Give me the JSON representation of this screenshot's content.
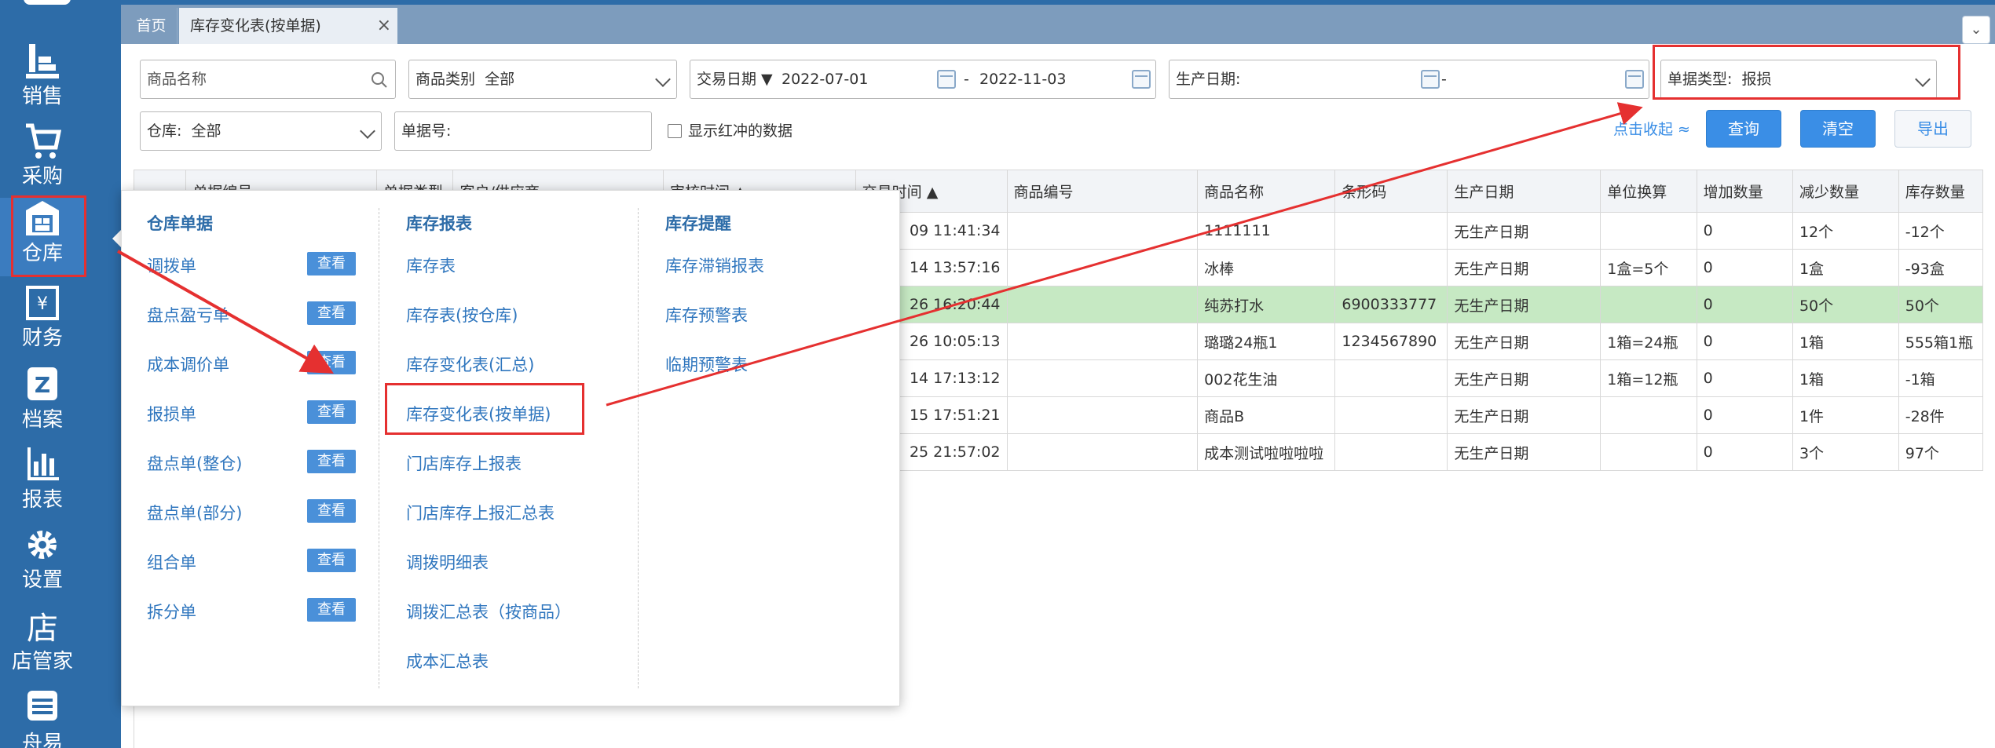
{
  "sidebar": {
    "items": [
      {
        "label": "销售",
        "icon": "sales-chart-icon"
      },
      {
        "label": "采购",
        "icon": "cart-icon"
      },
      {
        "label": "仓库",
        "icon": "warehouse-icon"
      },
      {
        "label": "财务",
        "icon": "yen-icon"
      },
      {
        "label": "档案",
        "icon": "archive-icon"
      },
      {
        "label": "报表",
        "icon": "report-chart-icon"
      },
      {
        "label": "设置",
        "icon": "gear-icon"
      },
      {
        "label": "店管家",
        "icon": "store-icon"
      },
      {
        "label": "舟易",
        "icon": "zhouyi-icon"
      }
    ],
    "active": "仓库"
  },
  "tabs": {
    "home": "首页",
    "current": "库存变化表(按单据)",
    "close": "×",
    "collapse_icon": "chevron-down-icon"
  },
  "filters": {
    "product_name_placeholder": "商品名称",
    "category_label": "商品类别",
    "category_value": "全部",
    "trade_date_label": "交易日期 ▼",
    "trade_date_from": "2022-07-01",
    "trade_date_sep": "-",
    "trade_date_to": "2022-11-03",
    "prod_date_label": "生产日期:",
    "prod_date_sep": "-",
    "doc_type_label": "单据类型:",
    "doc_type_value": "报损",
    "warehouse_label": "仓库:",
    "warehouse_value": "全部",
    "doc_no_label": "单据号:",
    "show_red_label": "显示红冲的数据",
    "collapse_link": "点击收起 ≈",
    "query_button": "查询",
    "clear_button": "清空",
    "export_button": "导出"
  },
  "table": {
    "partial_headers": [
      "单据编号",
      "单据类型",
      "客户/供应商",
      "审核时间 ▲",
      "交易时间 ▲"
    ],
    "headers": [
      "商品编号",
      "商品名称",
      "条形码",
      "生产日期",
      "单位换算",
      "增加数量",
      "减少数量",
      "库存数量"
    ],
    "rows": [
      {
        "time": "09 11:41:34",
        "code": "",
        "name": "1111111",
        "barcode": "",
        "prod_date": "无生产日期",
        "unit": "",
        "inc": "0",
        "dec": "12个",
        "stock": "-12个",
        "hl": false
      },
      {
        "time": "14 13:57:16",
        "code": "",
        "name": "冰棒",
        "barcode": "",
        "prod_date": "无生产日期",
        "unit": "1盒=5个",
        "inc": "0",
        "dec": "1盒",
        "stock": "-93盒",
        "hl": false
      },
      {
        "time": "26 16:20:44",
        "code": "",
        "name": "纯苏打水",
        "barcode": "6900333777",
        "prod_date": "无生产日期",
        "unit": "",
        "inc": "0",
        "dec": "50个",
        "stock": "50个",
        "hl": true
      },
      {
        "time": "26 10:05:13",
        "code": "",
        "name": "璐璐24瓶1",
        "barcode": "1234567890",
        "prod_date": "无生产日期",
        "unit": "1箱=24瓶",
        "inc": "0",
        "dec": "1箱",
        "stock": "555箱1瓶",
        "hl": false
      },
      {
        "time": "14 17:13:12",
        "code": "",
        "name": "002花生油",
        "barcode": "",
        "prod_date": "无生产日期",
        "unit": "1箱=12瓶",
        "inc": "0",
        "dec": "1箱",
        "stock": "-1箱",
        "hl": false
      },
      {
        "time": "15 17:51:21",
        "code": "",
        "name": "商品B",
        "barcode": "",
        "prod_date": "无生产日期",
        "unit": "",
        "inc": "0",
        "dec": "1件",
        "stock": "-28件",
        "hl": false
      },
      {
        "time": "25 21:57:02",
        "code": "",
        "name": "成本测试啦啦啦啦",
        "barcode": "",
        "prod_date": "无生产日期",
        "unit": "",
        "inc": "0",
        "dec": "3个",
        "stock": "97个",
        "hl": false
      }
    ]
  },
  "menu": {
    "col1_title": "仓库单据",
    "col1_items": [
      "调拨单",
      "盘点盈亏单",
      "成本调价单",
      "报损单",
      "盘点单(整仓)",
      "盘点单(部分)",
      "组合单",
      "拆分单"
    ],
    "view_label": "查看",
    "col2_title": "库存报表",
    "col2_items": [
      "库存表",
      "库存表(按仓库)",
      "库存变化表(汇总)",
      "库存变化表(按单据)",
      "门店库存上报表",
      "门店库存上报汇总表",
      "调拨明细表",
      "调拨汇总表（按商品）",
      "成本汇总表"
    ],
    "col3_title": "库存提醒",
    "col3_items": [
      "库存滞销报表",
      "库存预警表",
      "临期预警表"
    ]
  },
  "colors": {
    "sidebar": "#2d6ca8",
    "accent": "#3a8ee6",
    "highlight_row": "#c6e9c3",
    "annotation": "#e53030"
  }
}
